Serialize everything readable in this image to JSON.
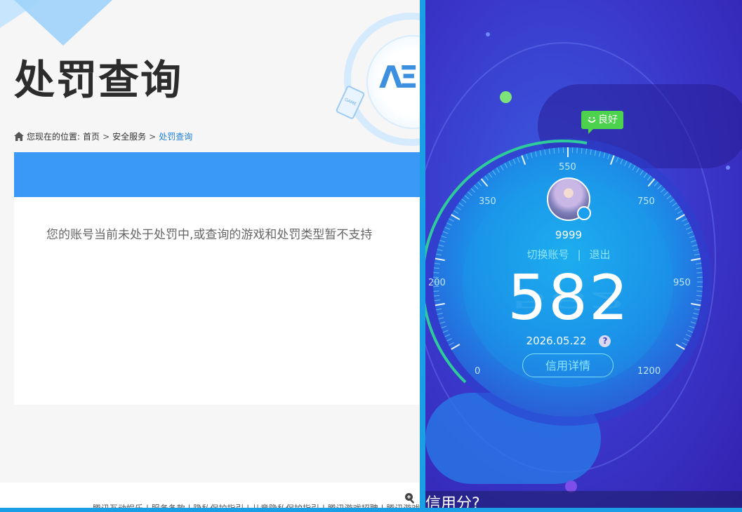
{
  "left": {
    "title": "处罚查询",
    "breadcrumb": {
      "prefix": "您现在的位置:",
      "home": "首页",
      "sep": ">",
      "section": "安全服务",
      "current": "处罚查询"
    },
    "message": "您的账号当前未处于处罚中,或查询的游戏和处罚类型暂不支持",
    "footer": "腾讯互动娱乐 | 服务条款 | 隐私保护指引 | 儿童隐私保护指引 | 腾讯游戏招聘 | 腾讯游戏客服"
  },
  "right": {
    "badge": "良好",
    "gauge_ticks": [
      "0",
      "200",
      "350",
      "550",
      "750",
      "950",
      "1200"
    ],
    "username": "9999",
    "switch_account": "切换账号",
    "separator": "|",
    "logout": "退出",
    "score": "582",
    "date": "2026.05.22",
    "help": "?",
    "detail_button": "信用详情",
    "bottom_text": "信用分?"
  },
  "colors": {
    "accent_blue": "#3a98f7",
    "link_blue": "#1e7fd8",
    "good_green": "#4cd24c",
    "score_arc": "#2ecc9a"
  },
  "icons": [
    "home-icon",
    "zoom-icon",
    "smile-icon",
    "qq-icon",
    "help-icon"
  ]
}
